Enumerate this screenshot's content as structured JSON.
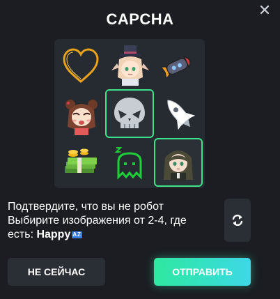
{
  "dialog": {
    "title": "CAPCHA",
    "close_label": "✕"
  },
  "grid": {
    "tiles": [
      {
        "icon": "heart-outline-icon",
        "selected": false
      },
      {
        "icon": "anime-girl-top-hat-icon",
        "selected": false
      },
      {
        "icon": "rocket-capsule-icon",
        "selected": false
      },
      {
        "icon": "anime-girl-brown-hair-icon",
        "selected": false
      },
      {
        "icon": "skull-icon",
        "selected": true
      },
      {
        "icon": "rocket-icon",
        "selected": false
      },
      {
        "icon": "money-stack-icon",
        "selected": false
      },
      {
        "icon": "green-ghost-icon",
        "selected": false
      },
      {
        "icon": "anime-girl-green-hair-icon",
        "selected": true
      }
    ]
  },
  "prompt": {
    "line1": "Подтвердите, что вы не робот",
    "line2": "Выбирите изображения от 2-4, где",
    "line3_prefix": "есть: ",
    "keyword": "Happy",
    "lang_badge": "AZ"
  },
  "buttons": {
    "later": "НЕ СЕЙЧАС",
    "submit": "ОТПРАВИТЬ"
  },
  "colors": {
    "background": "#1b1d22",
    "panel": "#262a31",
    "selected_border": "#3de38b",
    "submit_gradient_start": "#2ee8a0",
    "submit_gradient_end": "#3fd7e8"
  }
}
